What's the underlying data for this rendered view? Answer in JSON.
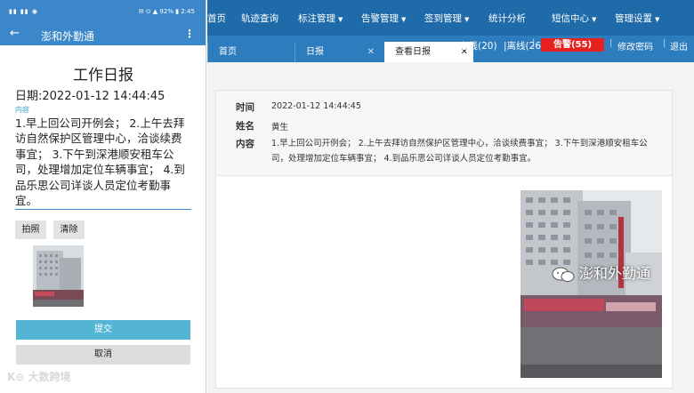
{
  "phone": {
    "status_left": "▮▮ ▮▮ ◉",
    "status_right": "✉ ⊙ ▲ 92% ▮ 2:45",
    "app_title": "澎和外勤通",
    "back_icon": "arrow-left-icon",
    "more_icon": "more-vert-icon",
    "heading": "工作日报",
    "date_line": "日期:2022-01-12 14:44:45",
    "content_label": "内容",
    "content": "1.早上回公司开例会； 2.上午去拜访自然保护区管理中心，洽谈续费事宜； 3.下午到深港顺安租车公司，处理增加定位车辆事宜； 4.到品乐思公司详谈人员定位考勤事宜。",
    "photo_btn": "拍照",
    "clear_btn": "清除",
    "submit_btn": "提交",
    "cancel_btn": "取消",
    "watermark": "K⊙ 大数跨境"
  },
  "web": {
    "nav": {
      "home": "首页",
      "track": "轨迹查询",
      "mark": "标注管理",
      "alarm": "告警管理",
      "checkin": "签到管理",
      "stats": "统计分析",
      "sms": "短信中心",
      "settings": "管理设置"
    },
    "tabs": {
      "home": "首页",
      "daily": "日报",
      "view": "查看日报"
    },
    "status": {
      "online": "在线(20)",
      "offline": "|离线(26)",
      "alarm": "告警(55)",
      "change_pwd": "修改密码",
      "logout": "退出"
    },
    "report": {
      "time_label": "时间",
      "time_value": "2022-01-12 14:44:45",
      "name_label": "姓名",
      "name_value": "黄生",
      "content_label": "内容",
      "content_value": "1.早上回公司开例会； 2.上午去拜访自然保护区管理中心，洽谈续费事宜； 3.下午到深港顺安租车公司，处理增加定位车辆事宜； 4.到品乐思公司详谈人员定位考勤事宜。"
    },
    "watermark": "澎和外勤通"
  },
  "colors": {
    "app_blue": "#3b87c9",
    "nav_blue": "#1f6aa9",
    "tab_blue": "#2d7cbd",
    "submit_blue": "#54b4d3",
    "alarm_red": "#e8201e"
  }
}
